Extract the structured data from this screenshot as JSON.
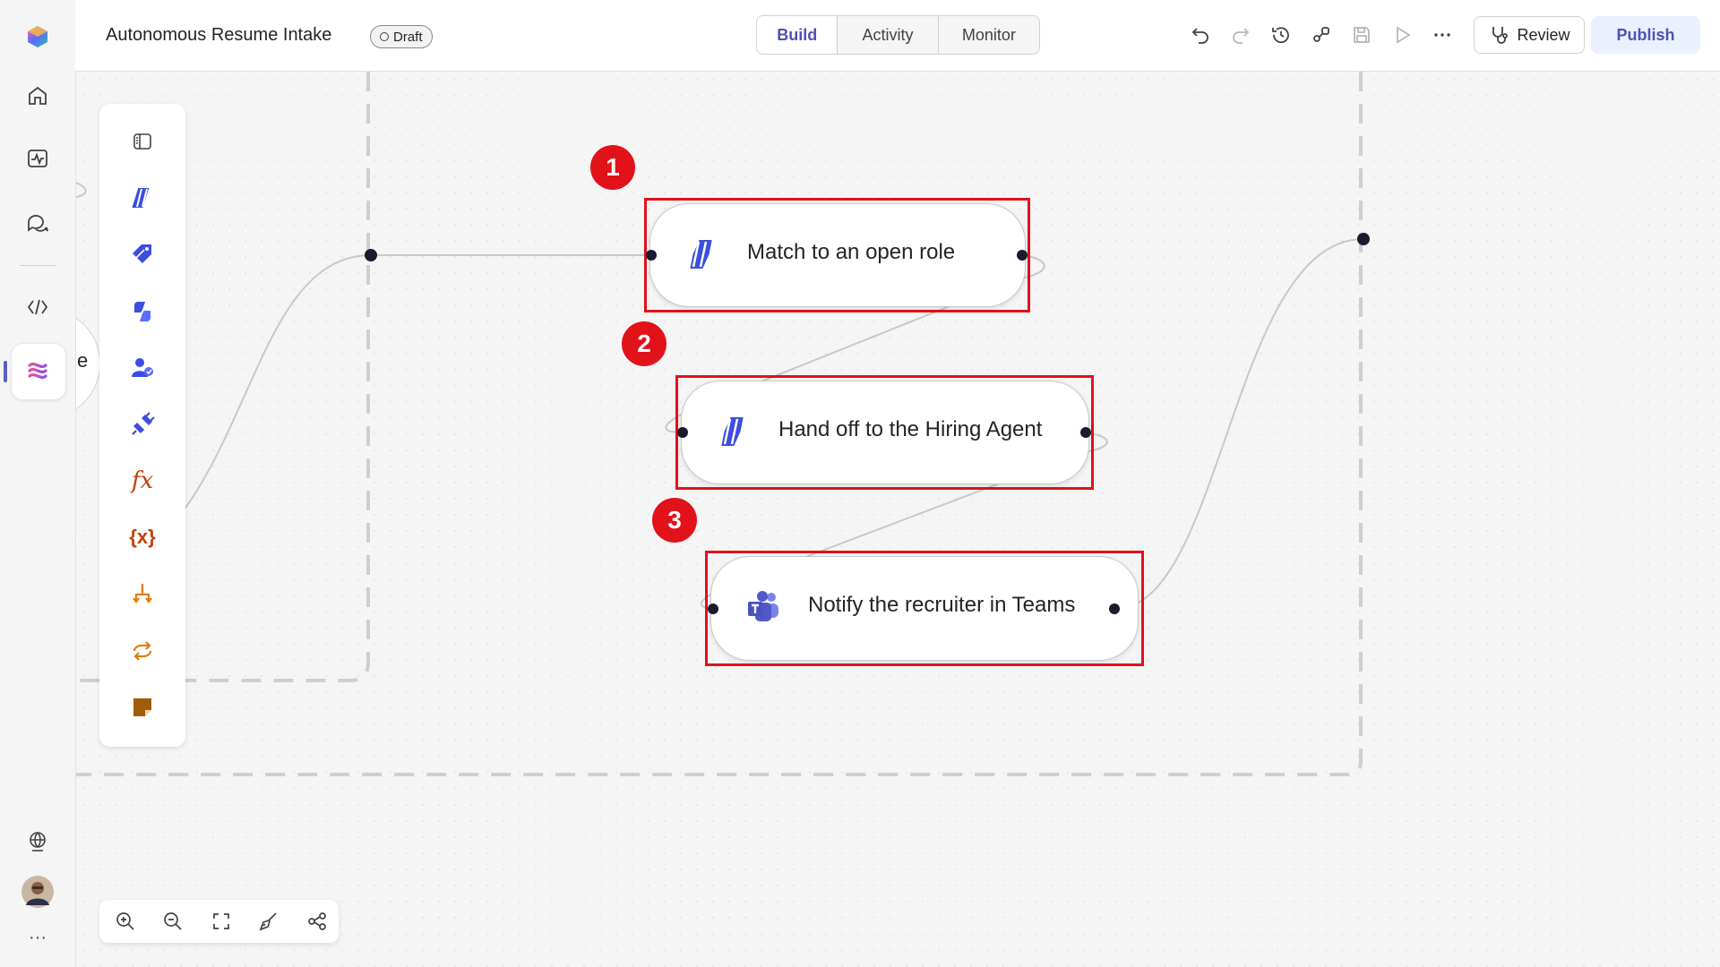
{
  "app": {
    "title": "Autonomous Resume Intake",
    "status": "Draft"
  },
  "tabs": [
    {
      "label": "Build",
      "active": true
    },
    {
      "label": "Activity",
      "active": false
    },
    {
      "label": "Monitor",
      "active": false
    }
  ],
  "actions": {
    "review_label": "Review",
    "publish_label": "Publish"
  },
  "nav": {
    "items": [
      "copilot-logo-icon",
      "home-icon",
      "activity-icon",
      "chat-icon",
      "code-icon",
      "flows-icon",
      "globe-icon",
      "avatar",
      "more-icon"
    ],
    "more_label": "···",
    "active_item": "flows-icon"
  },
  "flow": {
    "partial_node_label": "e",
    "nodes": [
      {
        "label": "Match to an open role",
        "icon": "agent-stripes-icon",
        "step": "1"
      },
      {
        "label": "Hand off to the Hiring Agent",
        "icon": "agent-stripes-icon",
        "step": "2"
      },
      {
        "label": "Notify the recruiter in Teams",
        "icon": "teams-icon",
        "step": "3"
      }
    ]
  },
  "toolbox": {
    "items": [
      "panel-toggle-icon",
      "agent-icon",
      "tag-icon",
      "copilot-icon",
      "people-icon",
      "plugin-icon",
      "function-fx-icon",
      "variable-icon",
      "branch-icon",
      "loop-icon",
      "note-icon"
    ],
    "fx_label": "fx",
    "variable_label": "{x}"
  },
  "zoom": {
    "items": [
      "zoom-in-icon",
      "zoom-out-icon",
      "fit-view-icon",
      "tidy-up-icon",
      "layout-icon"
    ]
  },
  "colors": {
    "accent": "#4f52b2",
    "highlight": "#e1121a",
    "agent_blue": "#3c4de0",
    "orange": "#e07d10",
    "red_fx": "#c2410c"
  }
}
